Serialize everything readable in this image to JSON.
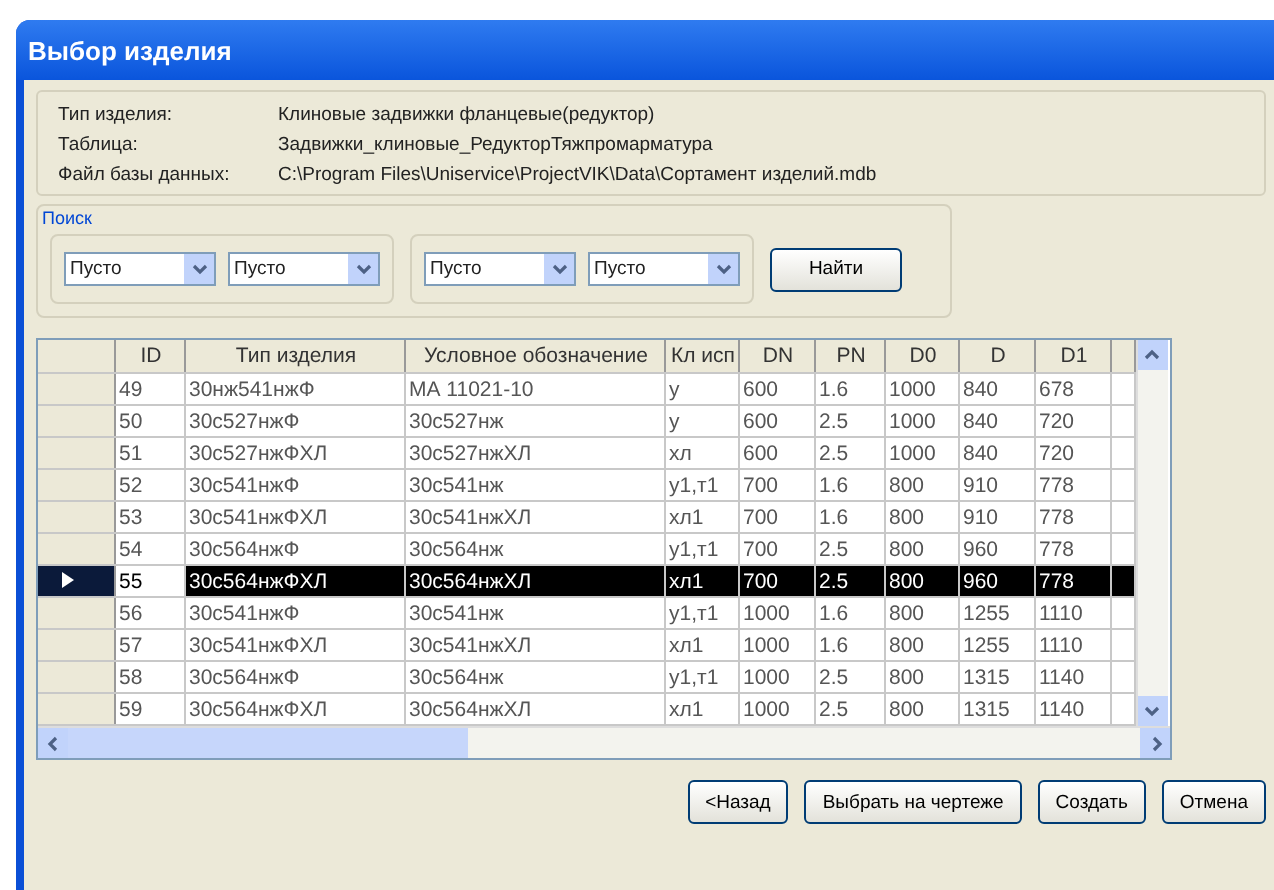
{
  "window": {
    "title": "Выбор изделия"
  },
  "info": [
    {
      "label": "Тип изделия:",
      "value": "Клиновые задвижки фланцевые(редуктор)"
    },
    {
      "label": "Таблица:",
      "value": "Задвижки_клиновые_РедукторТяжпромарматура"
    },
    {
      "label": "Файл базы данных:",
      "value": "C:\\Program Files\\Uniservice\\ProjectVIK\\Data\\Сортамент изделий.mdb"
    }
  ],
  "search": {
    "title": "Поиск",
    "groups": [
      [
        "Пусто",
        "Пусто"
      ],
      [
        "Пусто",
        "Пусто"
      ]
    ],
    "button": "Найти"
  },
  "table": {
    "columns": [
      "ID",
      "Тип изделия",
      "Условное обозначение",
      "Кл исп",
      "DN",
      "PN",
      "D0",
      "D",
      "D1"
    ],
    "rows": [
      {
        "cells": [
          "49",
          "30нж541нжФ",
          "МА 11021-10",
          "у",
          "600",
          "1.6",
          "1000",
          "840",
          "678"
        ],
        "selected": false
      },
      {
        "cells": [
          "50",
          "30с527нжФ",
          "30с527нж",
          "у",
          "600",
          "2.5",
          "1000",
          "840",
          "720"
        ],
        "selected": false
      },
      {
        "cells": [
          "51",
          "30с527нжФХЛ",
          "30с527нжХЛ",
          "хл",
          "600",
          "2.5",
          "1000",
          "840",
          "720"
        ],
        "selected": false
      },
      {
        "cells": [
          "52",
          "30с541нжФ",
          "30с541нж",
          "у1,т1",
          "700",
          "1.6",
          "800",
          "910",
          "778"
        ],
        "selected": false
      },
      {
        "cells": [
          "53",
          "30с541нжФХЛ",
          "30с541нжХЛ",
          "хл1",
          "700",
          "1.6",
          "800",
          "910",
          "778"
        ],
        "selected": false
      },
      {
        "cells": [
          "54",
          "30с564нжФ",
          "30с564нж",
          "у1,т1",
          "700",
          "2.5",
          "800",
          "960",
          "778"
        ],
        "selected": false
      },
      {
        "cells": [
          "55",
          "30с564нжФХЛ",
          "30с564нжХЛ",
          "хл1",
          "700",
          "2.5",
          "800",
          "960",
          "778"
        ],
        "selected": true
      },
      {
        "cells": [
          "56",
          "30с541нжФ",
          "30с541нж",
          "у1,т1",
          "1000",
          "1.6",
          "800",
          "1255",
          "1110"
        ],
        "selected": false
      },
      {
        "cells": [
          "57",
          "30с541нжФХЛ",
          "30с541нжХЛ",
          "хл1",
          "1000",
          "1.6",
          "800",
          "1255",
          "1110"
        ],
        "selected": false
      },
      {
        "cells": [
          "58",
          "30с564нжФ",
          "30с564нж",
          "у1,т1",
          "1000",
          "2.5",
          "800",
          "1315",
          "1140"
        ],
        "selected": false
      },
      {
        "cells": [
          "59",
          "30с564нжФХЛ",
          "30с564нжХЛ",
          "хл1",
          "1000",
          "2.5",
          "800",
          "1315",
          "1140"
        ],
        "selected": false
      }
    ]
  },
  "buttons": [
    "<Назад",
    "Выбрать на чертеже",
    "Создать",
    "Отмена"
  ]
}
